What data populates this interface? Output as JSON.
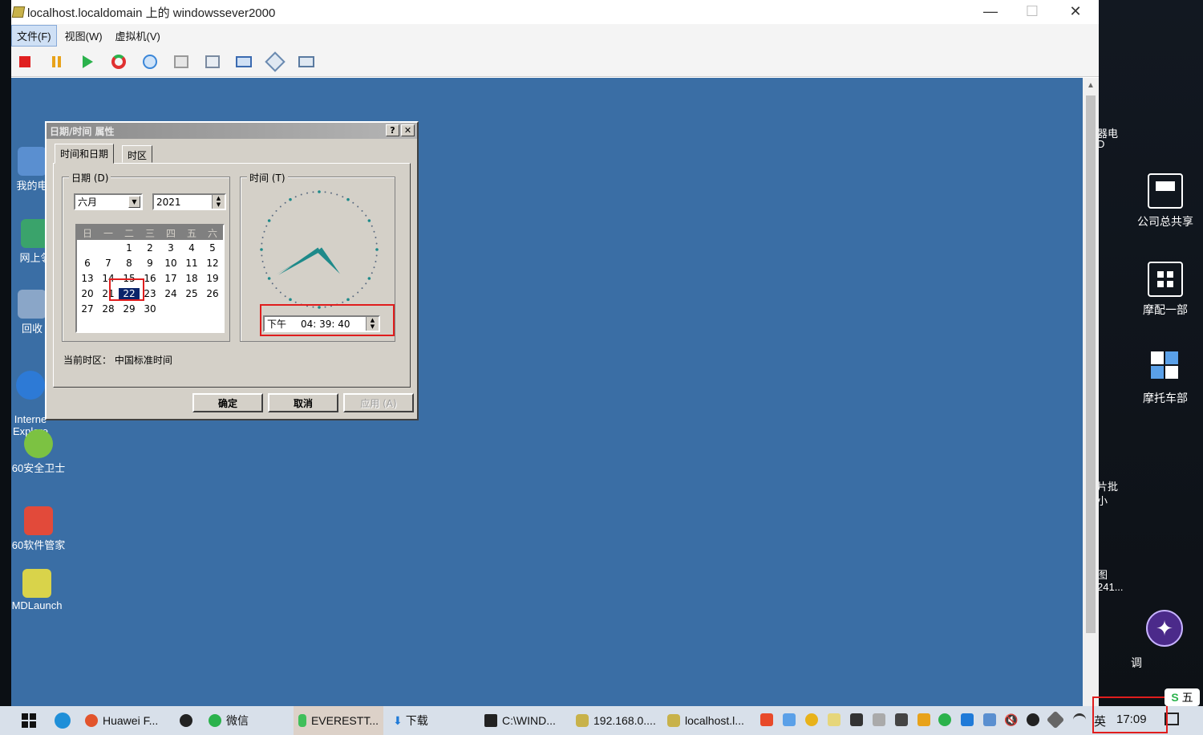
{
  "window": {
    "title": "localhost.localdomain 上的 windowssever2000",
    "minimize": "—",
    "maximize": "☐",
    "close": "✕"
  },
  "menu": [
    "文件(F)",
    "视图(W)",
    "虚拟机(V)"
  ],
  "toolbar_icons": [
    "stop-icon",
    "pause-icon",
    "play-icon",
    "reset-icon",
    "snapshot-icon",
    "revert-icon",
    "manage-snapshots-icon",
    "fullscreen-icon",
    "settings-icon",
    "console-icon"
  ],
  "guest_desktop": {
    "icons": [
      {
        "label": "我的电",
        "color": "#5a8fd0"
      },
      {
        "label": "网上邻",
        "color": "#3aa36b"
      },
      {
        "label": "回收",
        "color": "#8aa6c8"
      },
      {
        "label": "Interne\nExplore",
        "color": "#2d7ad6"
      },
      {
        "label": "60安全卫士",
        "color": "#7cc242"
      },
      {
        "label": "60软件管家",
        "color": "#e24a3a"
      },
      {
        "label": "MDLaunch",
        "color": "#d9d34a"
      }
    ]
  },
  "dialog": {
    "title": "日期/时间 属性",
    "help": "?",
    "close": "✕",
    "tabs": [
      "时间和日期",
      "时区"
    ],
    "date_group": "日期 (D)",
    "month": "六月",
    "year": "2021",
    "weekdays": [
      "日",
      "一",
      "二",
      "三",
      "四",
      "五",
      "六"
    ],
    "calendar_rows": [
      [
        "",
        "",
        "1",
        "2",
        "3",
        "4",
        "5"
      ],
      [
        "6",
        "7",
        "8",
        "9",
        "10",
        "11",
        "12"
      ],
      [
        "13",
        "14",
        "15",
        "16",
        "17",
        "18",
        "19"
      ],
      [
        "20",
        "21",
        "22",
        "23",
        "24",
        "25",
        "26"
      ],
      [
        "27",
        "28",
        "29",
        "30",
        "",
        "",
        ""
      ]
    ],
    "selected_day": "22",
    "time_group": "时间 (T)",
    "ampm": "下午",
    "time": "04: 39: 40",
    "timezone_text": "当前时区： 中国标准时间",
    "ok": "确定",
    "cancel": "取消",
    "apply": "应用 (A)"
  },
  "host_desktop": {
    "shortcuts": [
      {
        "label": "公司总共享"
      },
      {
        "label": "摩配一部"
      },
      {
        "label": "摩托车部"
      },
      {
        "label": "调"
      }
    ],
    "edge_texts": [
      "器电",
      "D",
      "片批",
      "小",
      "图",
      "241..."
    ]
  },
  "taskbar": {
    "items": [
      "Huawei F...",
      "微信",
      "EVERESTT...",
      "下载",
      "C:\\WIND...",
      "192.168.0....",
      "localhost.l..."
    ],
    "ime": "英",
    "ime2": "五",
    "clock": "17:09"
  },
  "colors": {
    "guest_bg": "#3a6ea5",
    "dialog_face": "#d4d0c8",
    "highlight_red": "#e01d1d",
    "clock_hands": "#1e8a8a"
  }
}
